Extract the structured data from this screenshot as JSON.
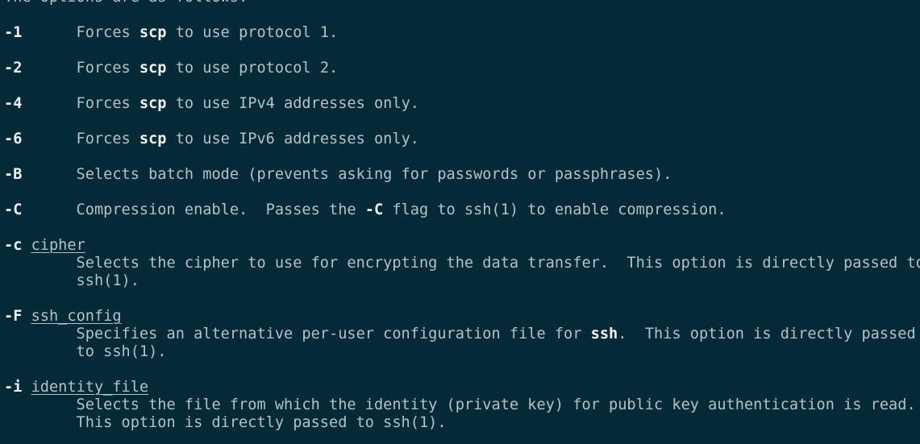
{
  "terminal": {
    "background_color": "#042a38",
    "foreground_color": "#b4c2c6",
    "bold_color": "#f2f4f4",
    "program": "man",
    "page": "scp",
    "section_intro": "The options are as follows:"
  },
  "lines": [
    {
      "id": "intro",
      "segments": [
        {
          "text": "The options are as follows:",
          "style": "normal"
        }
      ]
    },
    {
      "id": "blank-1",
      "segments": [
        {
          "text": "",
          "style": "normal"
        }
      ]
    },
    {
      "id": "opt-1",
      "segments": [
        {
          "text": "-1",
          "style": "bold"
        },
        {
          "text": "      Forces ",
          "style": "normal"
        },
        {
          "text": "scp",
          "style": "bold"
        },
        {
          "text": " to use protocol 1.",
          "style": "normal"
        }
      ]
    },
    {
      "id": "blank-2",
      "segments": [
        {
          "text": "",
          "style": "normal"
        }
      ]
    },
    {
      "id": "opt-2",
      "segments": [
        {
          "text": "-2",
          "style": "bold"
        },
        {
          "text": "      Forces ",
          "style": "normal"
        },
        {
          "text": "scp",
          "style": "bold"
        },
        {
          "text": " to use protocol 2.",
          "style": "normal"
        }
      ]
    },
    {
      "id": "blank-3",
      "segments": [
        {
          "text": "",
          "style": "normal"
        }
      ]
    },
    {
      "id": "opt-4",
      "segments": [
        {
          "text": "-4",
          "style": "bold"
        },
        {
          "text": "      Forces ",
          "style": "normal"
        },
        {
          "text": "scp",
          "style": "bold"
        },
        {
          "text": " to use IPv4 addresses only.",
          "style": "normal"
        }
      ]
    },
    {
      "id": "blank-4",
      "segments": [
        {
          "text": "",
          "style": "normal"
        }
      ]
    },
    {
      "id": "opt-6",
      "segments": [
        {
          "text": "-6",
          "style": "bold"
        },
        {
          "text": "      Forces ",
          "style": "normal"
        },
        {
          "text": "scp",
          "style": "bold"
        },
        {
          "text": " to use IPv6 addresses only.",
          "style": "normal"
        }
      ]
    },
    {
      "id": "blank-5",
      "segments": [
        {
          "text": "",
          "style": "normal"
        }
      ]
    },
    {
      "id": "opt-B",
      "segments": [
        {
          "text": "-B",
          "style": "bold"
        },
        {
          "text": "      Selects batch mode (prevents asking for passwords or passphrases).",
          "style": "normal"
        }
      ]
    },
    {
      "id": "blank-6",
      "segments": [
        {
          "text": "",
          "style": "normal"
        }
      ]
    },
    {
      "id": "opt-C-upper",
      "segments": [
        {
          "text": "-C",
          "style": "bold"
        },
        {
          "text": "      Compression enable.  Passes the ",
          "style": "normal"
        },
        {
          "text": "-C",
          "style": "bold"
        },
        {
          "text": " flag to ssh(1) to enable compression.",
          "style": "normal"
        }
      ]
    },
    {
      "id": "blank-7",
      "segments": [
        {
          "text": "",
          "style": "normal"
        }
      ]
    },
    {
      "id": "opt-c-lower",
      "segments": [
        {
          "text": "-c",
          "style": "bold"
        },
        {
          "text": " ",
          "style": "normal"
        },
        {
          "text": "cipher",
          "style": "underline"
        }
      ]
    },
    {
      "id": "opt-c-lower-desc-1",
      "segments": [
        {
          "text": "        Selects the cipher to use for encrypting the data transfer.  This option is directly passed to",
          "style": "normal"
        }
      ]
    },
    {
      "id": "opt-c-lower-desc-2",
      "segments": [
        {
          "text": "        ssh(1).",
          "style": "normal"
        }
      ]
    },
    {
      "id": "blank-8",
      "segments": [
        {
          "text": "",
          "style": "normal"
        }
      ]
    },
    {
      "id": "opt-F",
      "segments": [
        {
          "text": "-F",
          "style": "bold"
        },
        {
          "text": " ",
          "style": "normal"
        },
        {
          "text": "ssh_config",
          "style": "underline"
        }
      ]
    },
    {
      "id": "opt-F-desc-1",
      "segments": [
        {
          "text": "        Specifies an alternative per-user configuration file for ",
          "style": "normal"
        },
        {
          "text": "ssh",
          "style": "bold"
        },
        {
          "text": ".  This option is directly passed",
          "style": "normal"
        }
      ]
    },
    {
      "id": "opt-F-desc-2",
      "segments": [
        {
          "text": "        to ssh(1).",
          "style": "normal"
        }
      ]
    },
    {
      "id": "blank-9",
      "segments": [
        {
          "text": "",
          "style": "normal"
        }
      ]
    },
    {
      "id": "opt-i",
      "segments": [
        {
          "text": "-i",
          "style": "bold"
        },
        {
          "text": " ",
          "style": "normal"
        },
        {
          "text": "identity_file",
          "style": "underline"
        }
      ]
    },
    {
      "id": "opt-i-desc-1",
      "segments": [
        {
          "text": "        Selects the file from which the identity (private key) for public key authentication is read.",
          "style": "normal"
        }
      ]
    },
    {
      "id": "opt-i-desc-2",
      "segments": [
        {
          "text": "        This option is directly passed to ssh(1).",
          "style": "normal"
        }
      ]
    }
  ]
}
